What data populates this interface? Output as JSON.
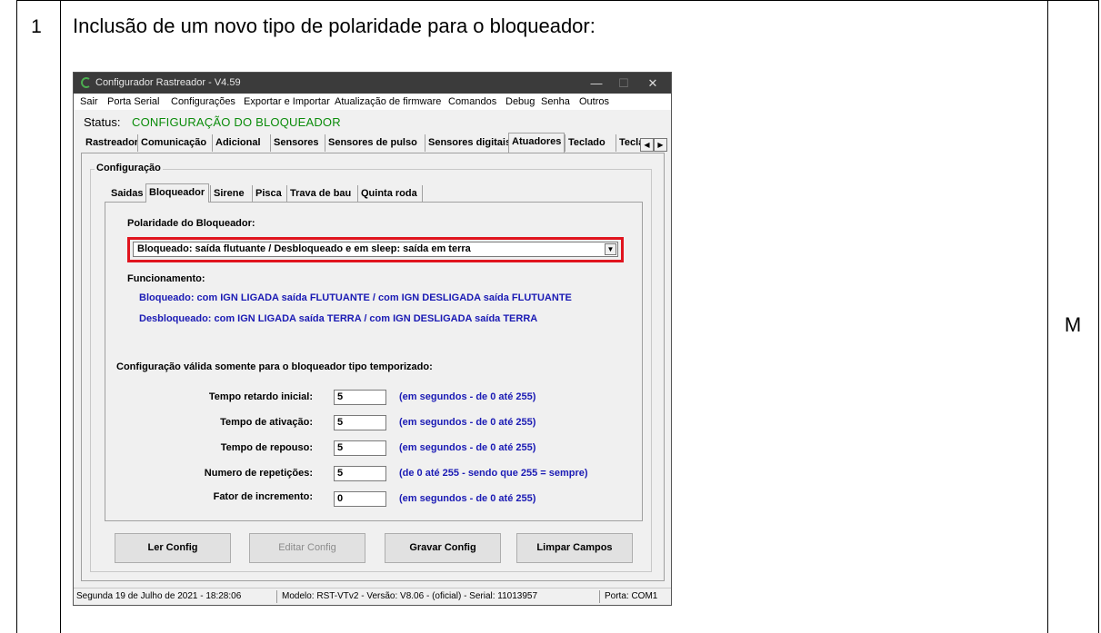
{
  "document": {
    "row_number": "1",
    "row_title": "Inclusão de um novo tipo de polaridade para o bloqueador:",
    "row_mark": "M"
  },
  "window": {
    "title": "Configurador Rastreador - V4.59",
    "controls": {
      "minimize": "—",
      "maximize": "☐",
      "close": "✕"
    },
    "menu": [
      "Sair",
      "Porta Serial",
      "Configurações",
      "Exportar e Importar",
      "Atualização de firmware",
      "Comandos",
      "Debug",
      "Senha",
      "Outros"
    ],
    "status_label": "Status:",
    "status_value": "CONFIGURAÇÃO DO BLOQUEADOR",
    "status_color": "#0a8c0a",
    "tabs": [
      "Rastreador",
      "Comunicação",
      "Adicional",
      "Sensores",
      "Sensores de pulso",
      "Sensores digitais",
      "Atuadores",
      "Teclado",
      "Tecla"
    ],
    "active_tab": "Atuadores",
    "group_title": "Configuração",
    "subtabs": [
      "Saidas",
      "Bloqueador",
      "Sirene",
      "Pisca",
      "Trava de bau",
      "Quinta roda"
    ],
    "active_subtab": "Bloqueador",
    "polarity_label": "Polaridade do Bloqueador:",
    "polarity_value": "Bloqueado: saída flutuante / Desbloqueado e em sleep: saída em terra",
    "highlight_color": "#e0141e",
    "funcionamento_label": "Funcionamento:",
    "func_line1": "Bloqueado: com IGN LIGADA saída FLUTUANTE / com IGN DESLIGADA saída FLUTUANTE",
    "func_line2": "Desbloqueado: com IGN LIGADA saída TERRA / com IGN DESLIGADA saída TERRA",
    "temp_note": "Configuração válida somente para o bloqueador tipo temporizado:",
    "fields": [
      {
        "label": "Tempo retardo inicial:",
        "value": "5",
        "hint": "(em segundos - de 0 até 255)"
      },
      {
        "label": "Tempo de ativação:",
        "value": "5",
        "hint": "(em segundos - de 0 até 255)"
      },
      {
        "label": "Tempo de repouso:",
        "value": "5",
        "hint": "(em segundos - de 0 até 255)"
      },
      {
        "label": "Numero de repetições:",
        "value": "5",
        "hint": "(de 0 até 255 - sendo que 255 = sempre)"
      },
      {
        "label": "Fator de incremento:",
        "value": "0",
        "hint": "(em segundos - de 0 até 255)"
      }
    ],
    "buttons": {
      "read": "Ler Config",
      "edit": "Editar Config",
      "save": "Gravar Config",
      "clear": "Limpar Campos"
    },
    "statusbar": {
      "datetime": "Segunda 19 de Julho de 2021  -  18:28:06",
      "model": "Modelo: RST-VTv2  -  Versão: V8.06 - (oficial)  -  Serial: 11013957",
      "port": "Porta: COM1"
    }
  }
}
